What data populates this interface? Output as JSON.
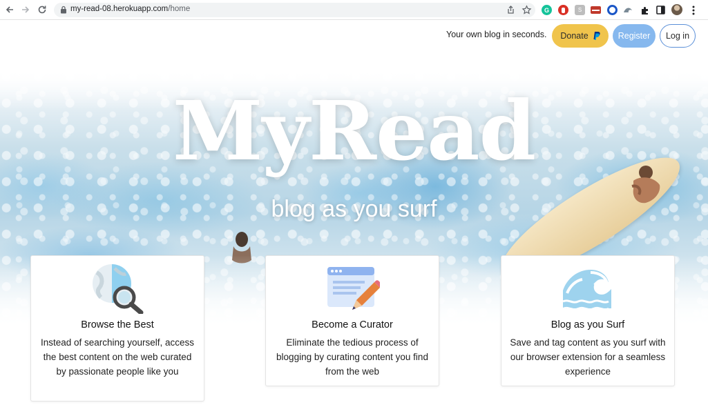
{
  "browser": {
    "url_domain": "my-read-08.herokuapp.com",
    "url_path": "/home"
  },
  "header": {
    "tagline": "Your own blog in seconds.",
    "donate_label": "Donate",
    "register_label": "Register",
    "login_label": "Log in"
  },
  "hero": {
    "title": "MyRead",
    "subtitle": "blog as you surf"
  },
  "features": [
    {
      "title": "Browse the Best",
      "text": "Instead of searching yourself, access the best content on the web curated by passionate people like you",
      "icon": "globe-magnifier-icon"
    },
    {
      "title": "Become a Curator",
      "text": "Eliminate the tedious process of blogging by curating content you find from the web",
      "icon": "document-pencil-icon"
    },
    {
      "title": "Blog as you Surf",
      "text": "Save and tag content as you surf with our browser extension for a seamless experience",
      "icon": "wave-icon"
    }
  ],
  "colors": {
    "donate": "#f0c44c",
    "register": "#86b8ee",
    "login_border": "#5a8fd8"
  }
}
